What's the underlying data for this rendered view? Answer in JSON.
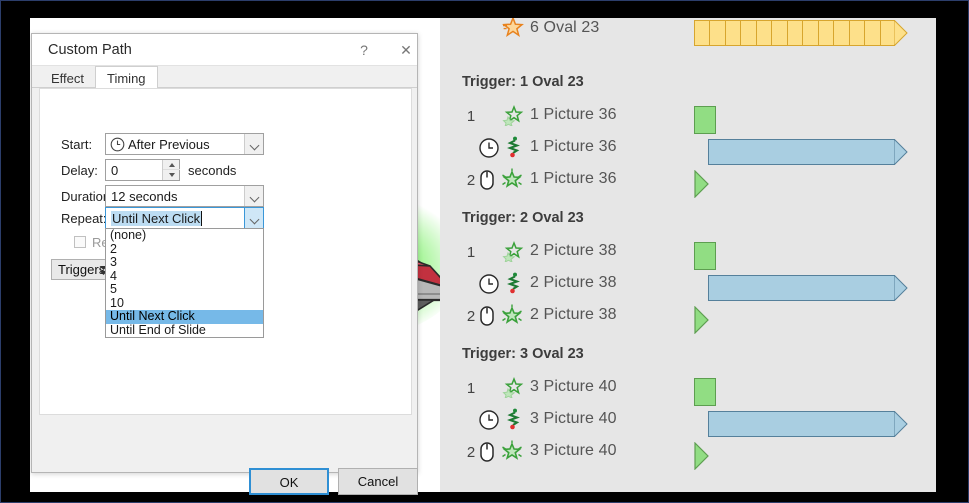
{
  "dialog": {
    "title": "Custom Path",
    "help_button": "?",
    "close_button": "✕",
    "tabs": [
      {
        "label": "Effect",
        "active": false
      },
      {
        "label": "Timing",
        "active": true
      }
    ],
    "fields": {
      "start": {
        "label": "Start:",
        "value": "After Previous",
        "icon": "clock-icon"
      },
      "delay": {
        "label": "Delay:",
        "value": "0",
        "unit": "seconds"
      },
      "duration": {
        "label": "Duration:",
        "value": "12 seconds"
      },
      "repeat": {
        "label": "Repeat:",
        "value": "Until Next Click"
      },
      "rewind": {
        "label": "Rewind w",
        "checked": false
      },
      "triggers": {
        "label": "Triggers"
      }
    },
    "repeat_dropdown": {
      "open": true,
      "options": [
        "(none)",
        "2",
        "3",
        "4",
        "5",
        "10",
        "Until Next Click",
        "Until End of Slide"
      ],
      "selected": "Until Next Click"
    },
    "buttons": {
      "ok": "OK",
      "cancel": "Cancel"
    }
  },
  "animation_pane": {
    "rows": [
      {
        "kind": "item",
        "num": "",
        "icon": "orange-star-icon",
        "label": "6 Oval 23",
        "bar": "yellow"
      },
      {
        "kind": "trigger",
        "label": "Trigger: 1 Oval 23"
      },
      {
        "kind": "item",
        "num": "1",
        "icon": "green-star-outline-icon",
        "label": "1 Picture 36",
        "bar": "green"
      },
      {
        "kind": "item",
        "num": "",
        "icon": "clock-icon",
        "label": "1 Picture 36",
        "bar": "blue",
        "icon2": "motion-path-icon"
      },
      {
        "kind": "item",
        "num": "2",
        "icon": "mouse-icon",
        "label": "1 Picture 36",
        "bar": "triangle",
        "icon2": "green-star-filled-icon"
      },
      {
        "kind": "trigger",
        "label": "Trigger: 2 Oval 23"
      },
      {
        "kind": "item",
        "num": "1",
        "icon": "green-star-outline-icon",
        "label": "2 Picture 38",
        "bar": "green"
      },
      {
        "kind": "item",
        "num": "",
        "icon": "clock-icon",
        "label": "2 Picture 38",
        "bar": "blue",
        "icon2": "motion-path-icon"
      },
      {
        "kind": "item",
        "num": "2",
        "icon": "mouse-icon",
        "label": "2 Picture 38",
        "bar": "triangle",
        "icon2": "green-star-filled-icon"
      },
      {
        "kind": "trigger",
        "label": "Trigger: 3 Oval 23"
      },
      {
        "kind": "item",
        "num": "1",
        "icon": "green-star-outline-icon",
        "label": "3 Picture 40",
        "bar": "green"
      },
      {
        "kind": "item",
        "num": "",
        "icon": "clock-icon",
        "label": "3 Picture 40",
        "bar": "blue",
        "icon2": "motion-path-icon"
      },
      {
        "kind": "item",
        "num": "2",
        "icon": "mouse-icon",
        "label": "3 Picture 40",
        "bar": "triangle",
        "icon2": "green-star-filled-icon"
      }
    ],
    "yellow_bar_segments": 13
  },
  "slide": {
    "image_name": "ufo-alien-spaceship"
  },
  "colors": {
    "bar_green_fill": "#91dd83",
    "bar_green_border": "#5d9e50",
    "bar_blue_fill": "#a9cee1",
    "bar_blue_border": "#55809b",
    "bar_yellow_fill": "#fde08a",
    "bar_yellow_border": "#d7a52e",
    "accent_focus": "#2f8fd4",
    "dropdown_selection": "#76b9e8",
    "pane_background": "#e6e6e6"
  }
}
